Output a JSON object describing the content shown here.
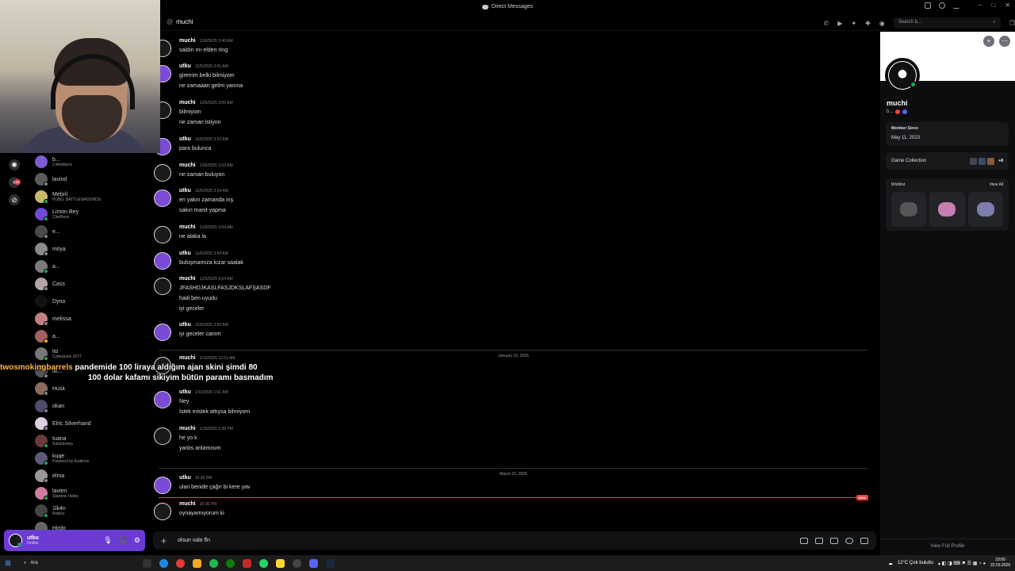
{
  "window": {
    "title": "Direct Messages"
  },
  "search": {
    "placeholder": "Search b..."
  },
  "chat": {
    "recipient": "muchi"
  },
  "dm_list": [
    {
      "name": "b...",
      "sub": "2 Members",
      "color": "#7b5cd6",
      "status": ""
    },
    {
      "name": "lavind",
      "sub": "",
      "color": "#5b5b5b",
      "status": "#80848e"
    },
    {
      "name": "Mebril",
      "sub": "PUBG: BATTLEGROUNDS",
      "color": "#c9b96b",
      "status": "#23a55a"
    },
    {
      "name": "Limon Bey",
      "sub": "ClanBeys",
      "color": "#6b4bd6",
      "status": "#23a55a"
    },
    {
      "name": "e...",
      "sub": "",
      "color": "#4a4a4a",
      "status": "#80848e"
    },
    {
      "name": "mitya",
      "sub": "",
      "color": "#8a8a8a",
      "status": "#80848e"
    },
    {
      "name": "a...",
      "sub": "",
      "color": "#7a7a7a",
      "status": "#23a55a"
    },
    {
      "name": "Cass",
      "sub": "",
      "color": "#b7a3a3",
      "status": "#80848e"
    },
    {
      "name": "Dyno",
      "sub": "",
      "color": "#111111",
      "status": ""
    },
    {
      "name": "melissa",
      "sub": "",
      "color": "#c28080",
      "status": "#80848e"
    },
    {
      "name": "a...",
      "sub": "",
      "color": "#a06060",
      "status": "#f0b232"
    },
    {
      "name": "ito",
      "sub": "Cyberpunk 2077",
      "color": "#777777",
      "status": "#23a55a"
    },
    {
      "name": "ilk...",
      "sub": "",
      "color": "#555555",
      "status": "#80848e"
    },
    {
      "name": "Husk",
      "sub": "",
      "color": "#8b6b5b",
      "status": "#80848e"
    },
    {
      "name": "okan",
      "sub": "",
      "color": "#4b4b6b",
      "status": "#80848e"
    },
    {
      "name": "Elric Silverhand",
      "sub": "",
      "color": "#ddd0e0",
      "status": "#80848e"
    },
    {
      "name": "tuana",
      "sub": "Satisfactory",
      "color": "#6b3b3b",
      "status": "#23a55a"
    },
    {
      "name": "kuqe",
      "sub": "Powered by Avallons",
      "color": "#5a5a7a",
      "status": "#23a55a"
    },
    {
      "name": "elma",
      "sub": "",
      "color": "#999999",
      "status": "#80848e"
    },
    {
      "name": "lavien",
      "sub": "Stardew Valley",
      "color": "#d07aa0",
      "status": "#23a55a"
    },
    {
      "name": "1lk4n",
      "sub": "Roblox",
      "color": "#444444",
      "status": "#23a55a"
    },
    {
      "name": "Hirdo",
      "sub": "",
      "color": "#666666",
      "status": "#80848e"
    }
  ],
  "user_panel": {
    "name": "utku",
    "status": "Online"
  },
  "messages": [
    {
      "user": "muchi",
      "time": "12/6/2025 3:40 AM",
      "lines": [
        "saldın mı elden ring"
      ],
      "av": "#1a1a1a"
    },
    {
      "user": "utku",
      "time": "12/6/2025 3:41 AM",
      "lines": [
        "girerrim belki bilmiyom",
        "ne  zamaaan gelim yanına"
      ],
      "av": "#7b4bd6"
    },
    {
      "user": "muchi",
      "time": "12/6/2025 3:50 AM",
      "lines": [
        "bilmiyom",
        "ne zaman istiyon"
      ],
      "av": "#1a1a1a"
    },
    {
      "user": "utku",
      "time": "12/6/2025 3:52 AM",
      "lines": [
        "para bulunca"
      ],
      "av": "#7b4bd6"
    },
    {
      "user": "muchi",
      "time": "12/6/2025 3:53 AM",
      "lines": [
        "ne zaman buluyon"
      ],
      "av": "#1a1a1a"
    },
    {
      "user": "utku",
      "time": "12/6/2025 3:54 AM",
      "lines": [
        "en yakın zamanda inş",
        "sakın manit yapma"
      ],
      "av": "#7b4bd6"
    },
    {
      "user": "muchi",
      "time": "12/6/2025 3:54 AM",
      "lines": [
        "ne alaka la"
      ],
      "av": "#1a1a1a"
    },
    {
      "user": "utku",
      "time": "12/6/2025 3:54 AM",
      "lines": [
        "buluşmamıza kızar saalak"
      ],
      "av": "#7b4bd6"
    },
    {
      "user": "muchi",
      "time": "12/6/2025 3:54 AM",
      "lines": [
        "JFASHDJKASLFASJDKSLAFŞASDF",
        "hadi ben uyudu",
        "iyi geceler"
      ],
      "av": "#1a1a1a"
    },
    {
      "user": "utku",
      "time": "12/6/2025 3:55 AM",
      "lines": [
        "iyi geceler canım"
      ],
      "av": "#7b4bd6"
    },
    {
      "user": "muchi",
      "time": "1/10/2026 12:51 AM",
      "lines": [
        ""
      ],
      "av": "#1a1a1a"
    },
    {
      "user": "utku",
      "time": "1/10/2026 1:01 AM",
      "lines": [
        "Ney",
        "İstek mistek attıysa bilmiyom"
      ],
      "av": "#7b4bd6"
    },
    {
      "user": "muchi",
      "time": "1/10/2026 3:36 PM",
      "lines": [
        "he yo k",
        "yanlıs anlamısım"
      ],
      "av": "#1a1a1a"
    },
    {
      "user": "utku",
      "time": "10:26 PM",
      "lines": [
        "ulan benide çağır bi kere yav"
      ],
      "av": "#7b4bd6"
    },
    {
      "user": "muchi",
      "time": "10:36 PM",
      "lines": [
        "oynayamıyorum ki"
      ],
      "av": "#1a1a1a"
    }
  ],
  "dividers": [
    "January 10, 2026",
    "March 22, 2026"
  ],
  "new_badge": "NEW",
  "composer": {
    "value": "olsun valo fln"
  },
  "profile": {
    "name": "muchi",
    "tag": "b...",
    "member_since_label": "Member Since",
    "member_since": "May 11, 2023",
    "game_collection": "Game Collection",
    "game_count": "+8",
    "wishlist": "Wishlist",
    "view_all": "View All",
    "view_full_profile": "View Full Profile"
  },
  "overlay": {
    "username": "twosmokingbarrels",
    "line1": "pandemide 100 liraya aldığım ajan skini şimdi 80",
    "line2": "100 dolar kafamı sikiyim bütün paramı basmadım"
  },
  "taskbar": {
    "search": "Ara",
    "weather": "12°C  Çok bulutlu",
    "time": "23:00",
    "date": "22.03.2026"
  }
}
